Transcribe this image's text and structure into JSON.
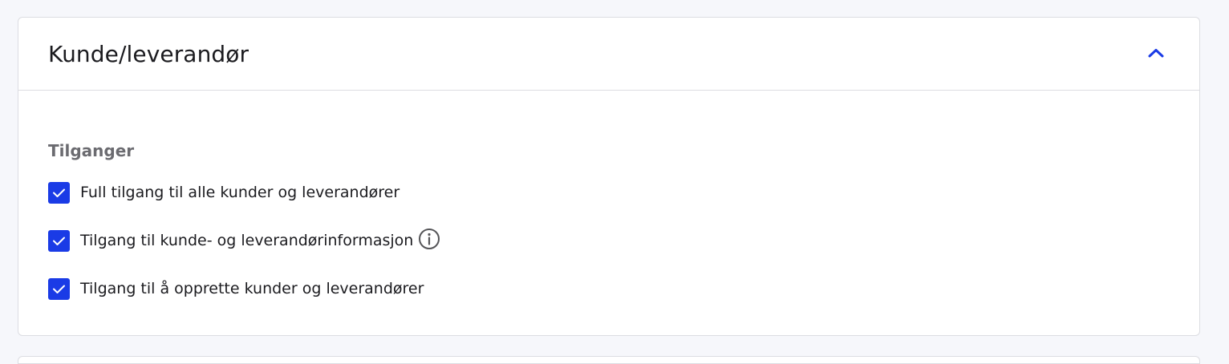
{
  "section": {
    "title": "Kunde/leverandør",
    "expanded": true
  },
  "permissions": {
    "heading": "Tilganger",
    "items": [
      {
        "label": "Full tilgang til alle kunder og leverandører",
        "checked": true,
        "has_info": false
      },
      {
        "label": "Tilgang til kunde- og leverandørinformasjon",
        "checked": true,
        "has_info": true
      },
      {
        "label": "Tilgang til å opprette kunder og leverandører",
        "checked": true,
        "has_info": false
      }
    ]
  },
  "icons": {
    "collapse": "chevron-up-icon",
    "check": "checkmark-icon",
    "info": "info-circle-icon"
  },
  "colors": {
    "accent": "#1a3be6",
    "page_background": "#f6f7fb",
    "card_border": "#dcdde2",
    "heading_gray": "#6b6b70"
  }
}
